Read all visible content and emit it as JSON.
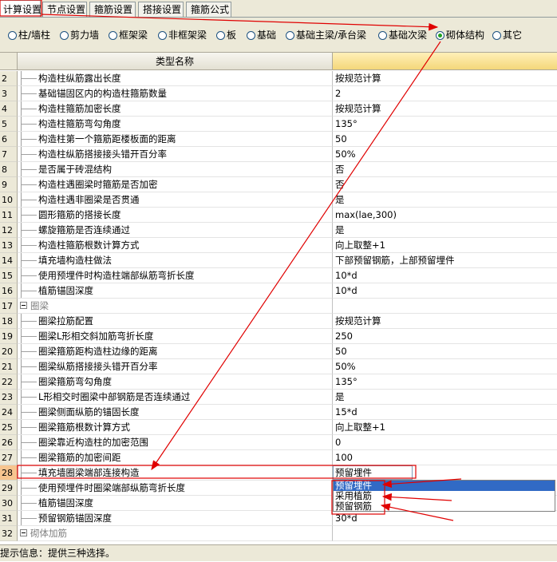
{
  "tabs": [
    {
      "label": "计算设置",
      "active": true
    },
    {
      "label": "节点设置",
      "active": false
    },
    {
      "label": "箍筋设置",
      "active": false
    },
    {
      "label": "搭接设置",
      "active": false
    },
    {
      "label": "箍筋公式",
      "active": false
    }
  ],
  "categories": [
    {
      "label": "柱/墙柱",
      "checked": false
    },
    {
      "label": "剪力墙",
      "checked": false
    },
    {
      "label": "框架梁",
      "checked": false
    },
    {
      "label": "非框架梁",
      "checked": false
    },
    {
      "label": "板",
      "checked": false
    },
    {
      "label": "基础",
      "checked": false
    },
    {
      "label": "基础主梁/承台梁",
      "checked": false
    },
    {
      "label": "基础次梁",
      "checked": false
    },
    {
      "label": "砌体结构",
      "checked": true
    },
    {
      "label": "其它",
      "checked": false
    }
  ],
  "grid": {
    "header_name": "类型名称",
    "rows": [
      {
        "num": "2",
        "name": "构造柱纵筋露出长度",
        "value": "按规范计算"
      },
      {
        "num": "3",
        "name": "基础锚固区内的构造柱箍筋数量",
        "value": "2"
      },
      {
        "num": "4",
        "name": "构造柱箍筋加密长度",
        "value": "按规范计算"
      },
      {
        "num": "5",
        "name": "构造柱箍筋弯勾角度",
        "value": "135°"
      },
      {
        "num": "6",
        "name": "构造柱第一个箍筋距楼板面的距离",
        "value": "50"
      },
      {
        "num": "7",
        "name": "构造柱纵筋搭接接头错开百分率",
        "value": "50%"
      },
      {
        "num": "8",
        "name": "是否属于砖混结构",
        "value": "否"
      },
      {
        "num": "9",
        "name": "构造柱遇圈梁时箍筋是否加密",
        "value": "否"
      },
      {
        "num": "10",
        "name": "构造柱遇非圈梁是否贯通",
        "value": "是"
      },
      {
        "num": "11",
        "name": "圆形箍筋的搭接长度",
        "value": "max(lae,300)"
      },
      {
        "num": "12",
        "name": "螺旋箍筋是否连续通过",
        "value": "是"
      },
      {
        "num": "13",
        "name": "构造柱箍筋根数计算方式",
        "value": "向上取整+1"
      },
      {
        "num": "14",
        "name": "填充墙构造柱做法",
        "value": "下部预留钢筋，上部预留埋件"
      },
      {
        "num": "15",
        "name": "使用预埋件时构造柱端部纵筋弯折长度",
        "value": "10*d"
      },
      {
        "num": "16",
        "name": "植筋锚固深度",
        "value": "10*d"
      },
      {
        "num": "17",
        "name": "圈梁",
        "value": "",
        "group": true
      },
      {
        "num": "18",
        "name": "圈梁拉筋配置",
        "value": "按规范计算"
      },
      {
        "num": "19",
        "name": "圈梁L形相交斜加筋弯折长度",
        "value": "250"
      },
      {
        "num": "20",
        "name": "圈梁箍筋距构造柱边缘的距离",
        "value": "50"
      },
      {
        "num": "21",
        "name": "圈梁纵筋搭接接头错开百分率",
        "value": "50%"
      },
      {
        "num": "22",
        "name": "圈梁箍筋弯勾角度",
        "value": "135°"
      },
      {
        "num": "23",
        "name": "L形相交时圈梁中部钢筋是否连续通过",
        "value": "是"
      },
      {
        "num": "24",
        "name": "圈梁侧面纵筋的锚固长度",
        "value": "15*d"
      },
      {
        "num": "25",
        "name": "圈梁箍筋根数计算方式",
        "value": "向上取整+1"
      },
      {
        "num": "26",
        "name": "圈梁靠近构造柱的加密范围",
        "value": "0"
      },
      {
        "num": "27",
        "name": "圈梁箍筋的加密间距",
        "value": "100"
      },
      {
        "num": "28",
        "name": "填充墙圈梁端部连接构造",
        "value": "预留埋件",
        "selected": true
      },
      {
        "num": "29",
        "name": "使用预埋件时圈梁端部纵筋弯折长度",
        "value": ""
      },
      {
        "num": "30",
        "name": "植筋锚固深度",
        "value": ""
      },
      {
        "num": "31",
        "name": "预留钢筋锚固深度",
        "value": "30*d"
      },
      {
        "num": "32",
        "name": "砌体加筋",
        "value": "",
        "group": true
      }
    ]
  },
  "dropdown": {
    "options": [
      "预留埋件",
      "采用植筋",
      "预留钢筋"
    ],
    "highlighted": 0
  },
  "status": {
    "text": "提示信息：提供三种选择。"
  },
  "colors": {
    "annotation": "#e00000",
    "selection": "#316ac5",
    "header_accent": "#f4d77a"
  }
}
